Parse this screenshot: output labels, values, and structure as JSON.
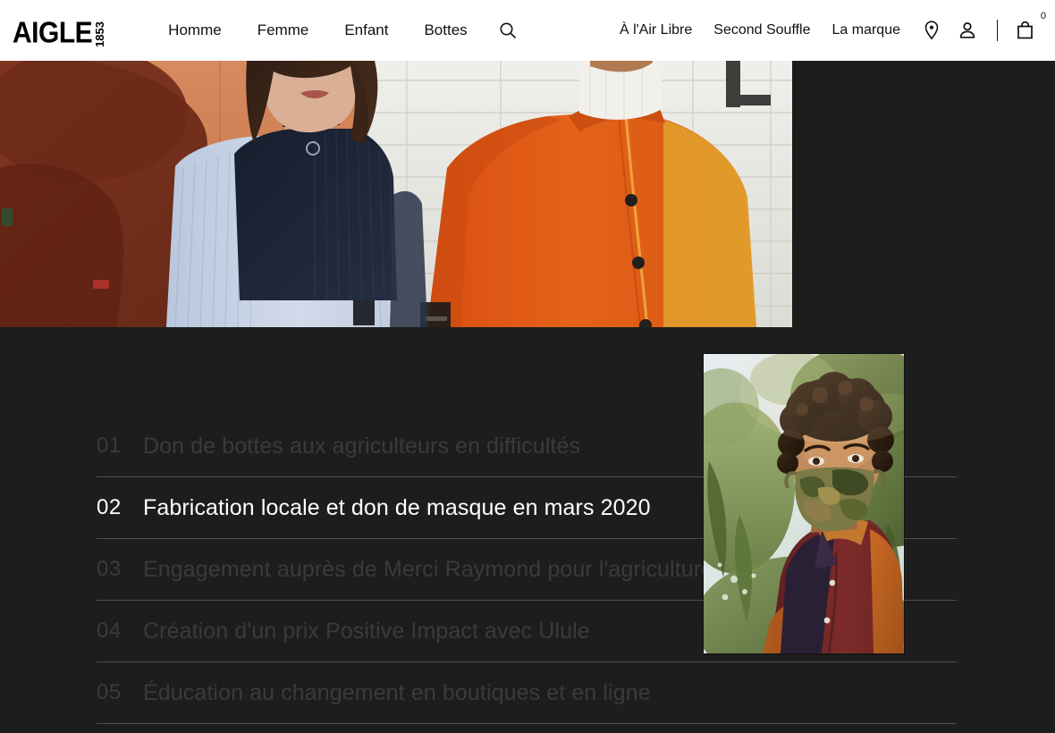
{
  "header": {
    "logo": {
      "brand": "AIGLE",
      "year": "1853"
    },
    "nav_left": [
      {
        "label": "Homme"
      },
      {
        "label": "Femme"
      },
      {
        "label": "Enfant"
      },
      {
        "label": "Bottes"
      }
    ],
    "search_icon": "search-icon",
    "nav_right": [
      {
        "label": "À l'Air Libre"
      },
      {
        "label": "Second Souffle"
      },
      {
        "label": "La marque"
      }
    ],
    "icons": {
      "store_locator": "location-pin-icon",
      "account": "user-icon",
      "cart": "shopping-bag-icon"
    },
    "cart_count": "0"
  },
  "hero": {
    "alt": "Two models wearing Aigle outerwear against a terracotta and white brick wall"
  },
  "impact": {
    "items": [
      {
        "number": "01",
        "title": "Don de bottes aux agriculteurs en difficultés",
        "active": false
      },
      {
        "number": "02",
        "title": "Fabrication locale et don de masque en mars 2020",
        "active": true
      },
      {
        "number": "03",
        "title": "Engagement auprès de Merci Raymond pour l'agriculture urbaine",
        "active": false
      },
      {
        "number": "04",
        "title": "Création d'un prix Positive Impact avec Ulule",
        "active": false
      },
      {
        "number": "05",
        "title": "Éducation au changement en boutiques et en ligne",
        "active": false
      }
    ]
  },
  "overlay": {
    "alt": "Young person wearing a camouflage face mask outdoors in greenery"
  },
  "colors": {
    "header_bg": "#ffffff",
    "header_text": "#111111",
    "dark_bg": "#1d1d1d",
    "active_text": "#ffffff",
    "inactive_text": "rgba(255,255,255,0.13)",
    "divider": "rgba(255,255,255,0.22)"
  }
}
